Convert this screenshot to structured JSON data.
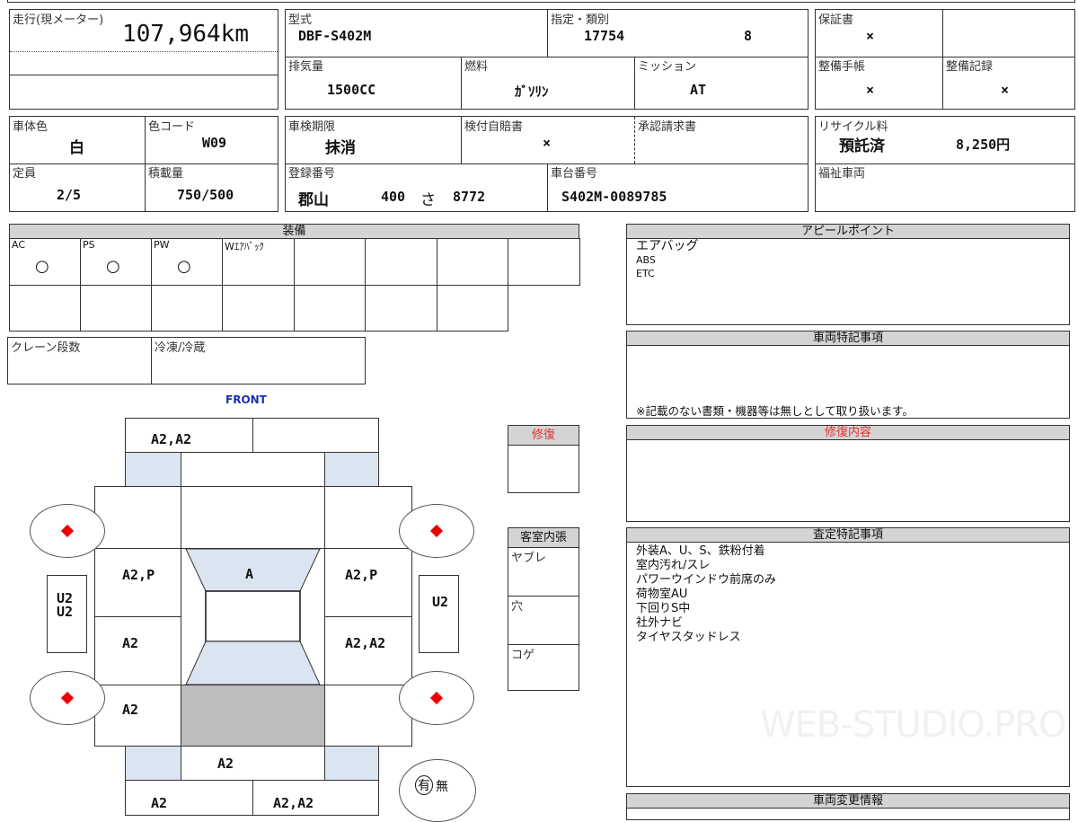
{
  "mileage": {
    "label": "走行(現メーター)",
    "value": "107,964km"
  },
  "model": {
    "label": "型式",
    "value": "DBF-S402M"
  },
  "designation": {
    "label": "指定・類別",
    "value1": "17754",
    "value2": "8"
  },
  "displacement": {
    "label": "排気量",
    "value": "1500CC"
  },
  "fuel": {
    "label": "燃料",
    "value": "ｶﾞｿﾘﾝ"
  },
  "transmission": {
    "label": "ミッション",
    "value": "AT"
  },
  "warranty": {
    "label": "保証書",
    "value": "×"
  },
  "maint_book": {
    "label": "整備手帳",
    "value": "×"
  },
  "maint_record": {
    "label": "整備記録",
    "value": "×"
  },
  "color": {
    "label": "車体色",
    "value": "白"
  },
  "color_code": {
    "label": "色コード",
    "value": "W09"
  },
  "inspection": {
    "label": "車検期限",
    "value": "抹消"
  },
  "insurance": {
    "label": "検付自賠書",
    "value": "×"
  },
  "approval": {
    "label": "承認請求書",
    "value": ""
  },
  "recycle": {
    "label": "リサイクル料",
    "status": "預託済",
    "amount": "8,250円"
  },
  "capacity": {
    "label": "定員",
    "value": "2/5"
  },
  "load": {
    "label": "積載量",
    "value": "750/500"
  },
  "registration": {
    "label": "登録番号",
    "region": "郡山",
    "class": "400",
    "kana": "さ",
    "number": "8772"
  },
  "chassis": {
    "label": "車台番号",
    "value": "S402M-0089785"
  },
  "welfare": {
    "label": "福祉車両",
    "value": ""
  },
  "equipment": {
    "title": "装備",
    "items": [
      {
        "label": "AC",
        "value": "○"
      },
      {
        "label": "PS",
        "value": "○"
      },
      {
        "label": "PW",
        "value": "○"
      },
      {
        "label": "Wｴｱﾊﾞｯｸ",
        "value": ""
      }
    ]
  },
  "crane": {
    "label": "クレーン段数"
  },
  "fridge": {
    "label": "冷凍/冷蔵"
  },
  "diagram": {
    "front": "FRONT",
    "front_bumper_left": "A2,A2",
    "left_front_door": "A2,P",
    "roof_glass": "A",
    "right_front_door": "A2,P",
    "left_rear_door": "A2",
    "right_rear_door": "A2,A2",
    "left_quarter": "A2",
    "rear_center": "A2",
    "rear_bumper_left": "A2",
    "rear_bumper_right": "A2,A2",
    "left_step": "U2\nU2",
    "right_step": "U2",
    "spare_yes": "有",
    "spare_no": "無"
  },
  "repair": {
    "title": "修復"
  },
  "interior": {
    "title": "客室内張",
    "rows": [
      "ヤブレ",
      "穴",
      "コゲ"
    ]
  },
  "appeal": {
    "title": "アピールポイント",
    "lines": [
      "エアバッグ",
      "ABS",
      "ETC"
    ]
  },
  "vehicle_notes": {
    "title": "車両特記事項",
    "note": "※記載のない書類・機器等は無しとして取り扱います。"
  },
  "repair_details": {
    "title": "修復内容"
  },
  "assessment": {
    "title": "査定特記事項",
    "lines": [
      "外装A、U、S、鉄粉付着",
      "室内汚れ/スレ",
      "パワーウインドウ前席のみ",
      "荷物室AU",
      "下回りS中",
      "社外ナビ",
      "タイヤスタッドレス"
    ]
  },
  "change_info": {
    "title": "車両変更情報"
  },
  "watermark": "WEB-STUDIO.PRO",
  "colors": {
    "accent_red": "#e03030",
    "front_blue": "#1a2fb0",
    "glass_blue": "#dbe5f1",
    "header_gray": "#d4d4d4"
  }
}
